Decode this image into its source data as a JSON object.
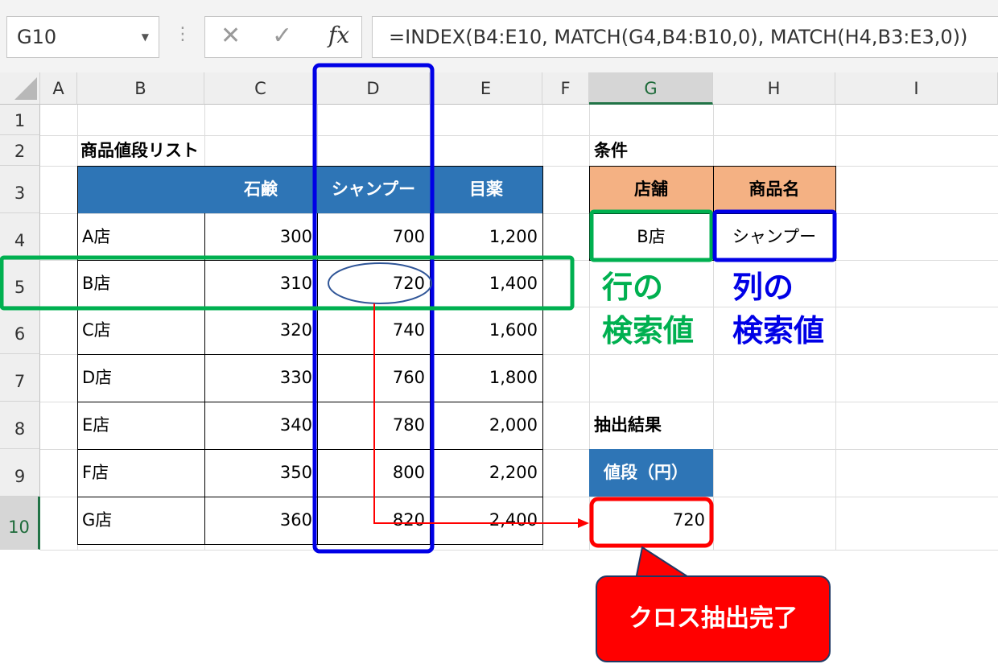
{
  "formula_bar": {
    "name_box": "G10",
    "cancel_icon": "✕",
    "enter_icon": "✓",
    "fx_label": "fx",
    "formula": "=INDEX(B4:E10, MATCH(G4,B4:B10,0), MATCH(H4,B3:E3,0))"
  },
  "columns": [
    "A",
    "B",
    "C",
    "D",
    "E",
    "F",
    "G",
    "H",
    "I"
  ],
  "rows": [
    "1",
    "2",
    "3",
    "4",
    "5",
    "6",
    "7",
    "8",
    "9",
    "10"
  ],
  "table": {
    "title": "商品値段リスト",
    "headers": [
      "",
      "石鹸",
      "シャンプー",
      "目薬"
    ],
    "rows": [
      {
        "store": "A店",
        "soap": "300",
        "shampoo": "700",
        "eyedrops": "1,200"
      },
      {
        "store": "B店",
        "soap": "310",
        "shampoo": "720",
        "eyedrops": "1,400"
      },
      {
        "store": "C店",
        "soap": "320",
        "shampoo": "740",
        "eyedrops": "1,600"
      },
      {
        "store": "D店",
        "soap": "330",
        "shampoo": "760",
        "eyedrops": "1,800"
      },
      {
        "store": "E店",
        "soap": "340",
        "shampoo": "780",
        "eyedrops": "2,000"
      },
      {
        "store": "F店",
        "soap": "350",
        "shampoo": "800",
        "eyedrops": "2,200"
      },
      {
        "store": "G店",
        "soap": "360",
        "shampoo": "820",
        "eyedrops": "2,400"
      }
    ]
  },
  "conditions": {
    "title": "条件",
    "store_header": "店舗",
    "product_header": "商品名",
    "store_value": "B店",
    "product_value": "シャンプー"
  },
  "result": {
    "title": "抽出結果",
    "header": "値段（円）",
    "value": "720"
  },
  "annotations": {
    "row_lookup_line1": "行の",
    "row_lookup_line2": "検索値",
    "col_lookup_line1": "列の",
    "col_lookup_line2": "検索値",
    "callout": "クロス抽出完了"
  },
  "colors": {
    "green": "#00b050",
    "blue": "#0000e6",
    "red": "#ff0000",
    "table_header": "#2e75b6",
    "condition_header": "#f4b183"
  }
}
